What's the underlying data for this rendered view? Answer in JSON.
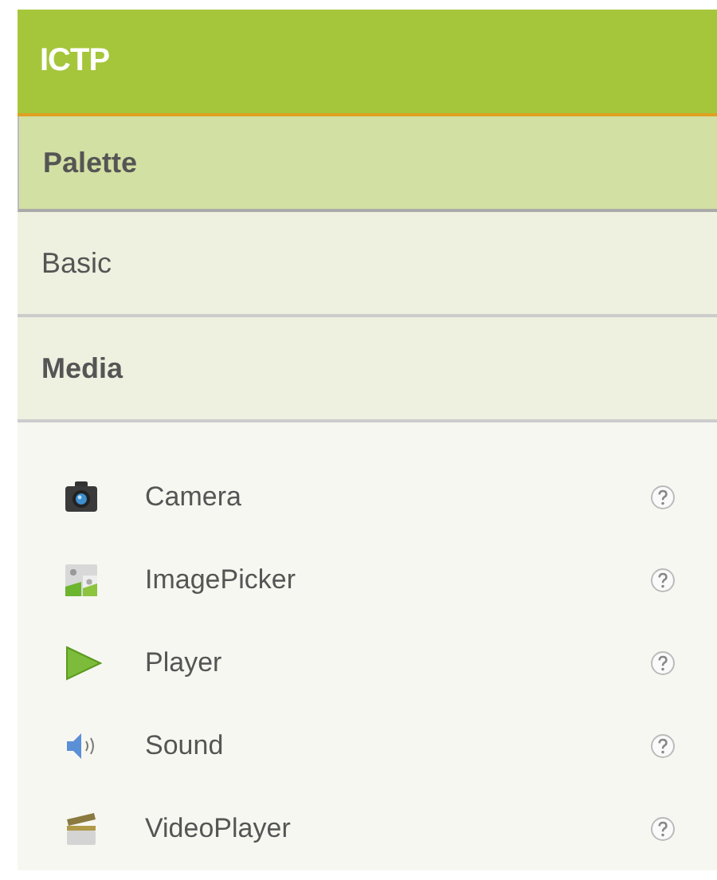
{
  "project": {
    "title": "ICTP"
  },
  "palette": {
    "title": "Palette",
    "categories": [
      {
        "label": "Basic",
        "expanded": false
      },
      {
        "label": "Media",
        "expanded": true
      }
    ],
    "components": [
      {
        "label": "Camera"
      },
      {
        "label": "ImagePicker"
      },
      {
        "label": "Player"
      },
      {
        "label": "Sound"
      },
      {
        "label": "VideoPlayer"
      }
    ]
  }
}
